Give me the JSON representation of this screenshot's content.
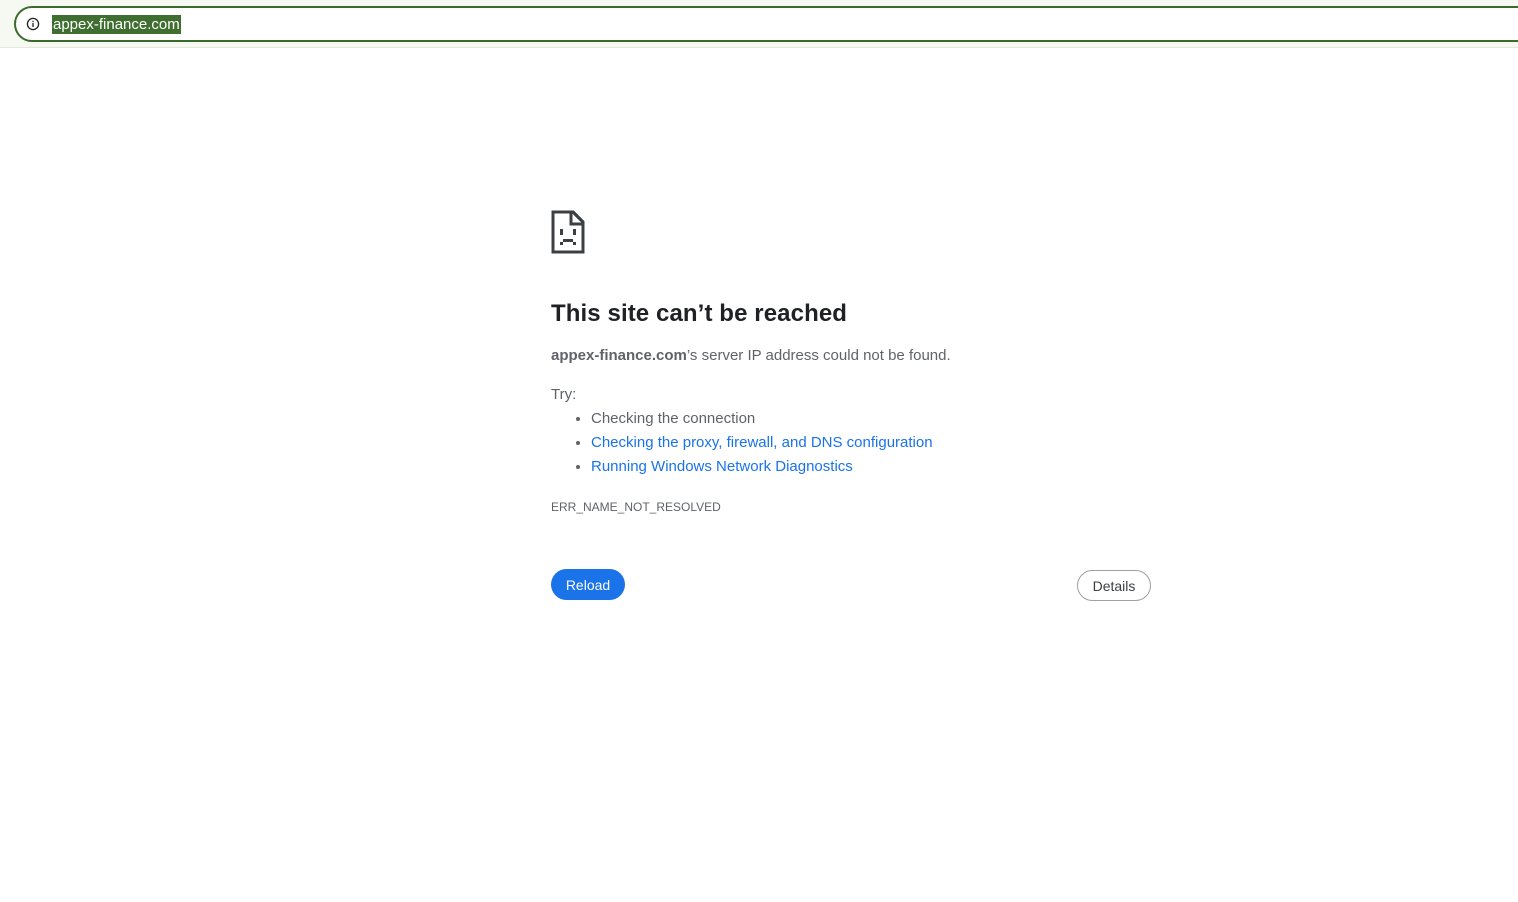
{
  "address_bar": {
    "url": "appex-finance.com",
    "icon": "info-icon"
  },
  "error_page": {
    "icon": "sad-document-icon",
    "title": "This site can’t be reached",
    "host": "appex-finance.com",
    "message_suffix": "’s server IP address could not be found.",
    "try_label": "Try:",
    "suggestions": [
      {
        "text": "Checking the connection",
        "link": false
      },
      {
        "text": "Checking the proxy, firewall, and DNS configuration",
        "link": true
      },
      {
        "text": "Running Windows Network Diagnostics",
        "link": true
      }
    ],
    "error_code": "ERR_NAME_NOT_RESOLVED",
    "reload_label": "Reload",
    "details_label": "Details"
  },
  "colors": {
    "accent": "#1a73e8",
    "omnibox_border": "#3a6b2a",
    "selection": "#3f6f30",
    "text_secondary": "#5f6368",
    "title": "#202124"
  }
}
